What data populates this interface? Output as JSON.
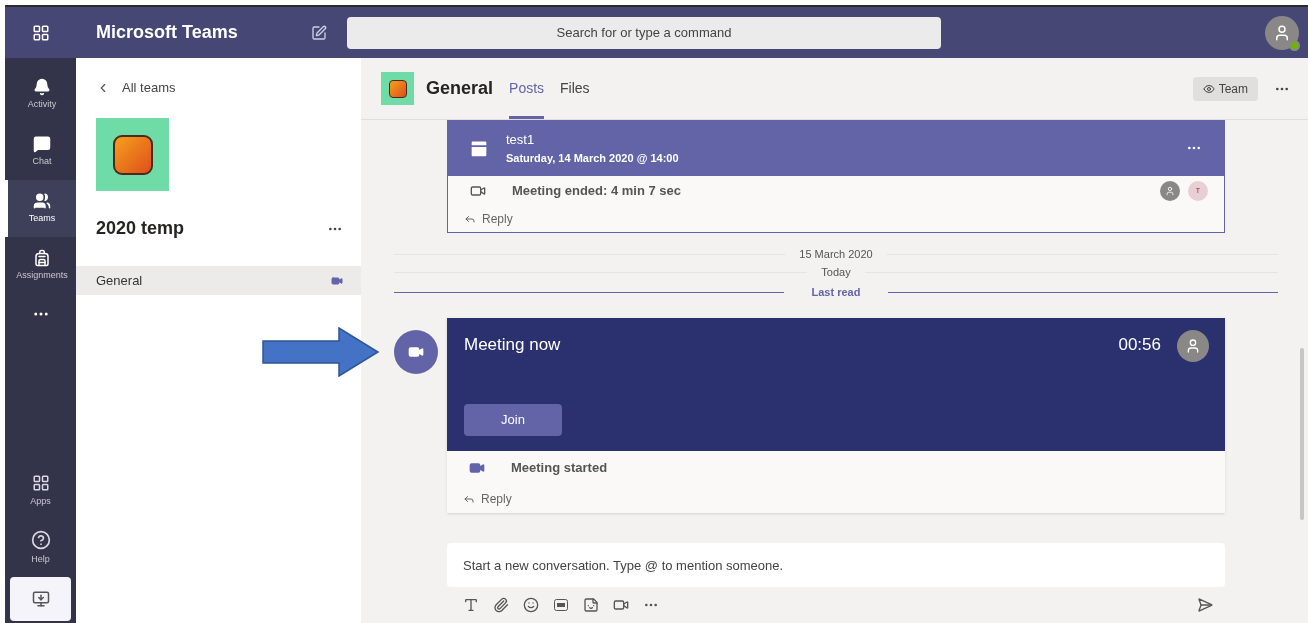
{
  "app": {
    "title": "Microsoft Teams",
    "search": {
      "placeholder": "Search for or type a command"
    }
  },
  "rail": {
    "items": [
      {
        "label": "Activity",
        "kind": "activity",
        "selected": false
      },
      {
        "label": "Chat",
        "kind": "chat",
        "selected": false
      },
      {
        "label": "Teams",
        "kind": "teams",
        "selected": true
      },
      {
        "label": "Assignments",
        "kind": "assignments",
        "selected": false
      }
    ],
    "bottom_items": [
      {
        "label": "Apps",
        "kind": "apps"
      },
      {
        "label": "Help",
        "kind": "help"
      }
    ]
  },
  "team_panel": {
    "back": "All teams",
    "team_name": "2020 temp",
    "channels": [
      {
        "name": "General",
        "selected": true,
        "meeting_active": true
      }
    ]
  },
  "channel": {
    "name": "General",
    "tabs": [
      {
        "label": "Posts",
        "selected": true
      },
      {
        "label": "Files",
        "selected": false
      }
    ],
    "team_button": "Team"
  },
  "posts": [
    {
      "title": "test1",
      "subtitle": "Saturday, 14 March 2020 @ 14:00",
      "status": "Meeting ended: 4 min 7 sec",
      "reply": "Reply",
      "participants": [
        {
          "color": "#8a8886"
        },
        {
          "initial": "T",
          "color": "#e8cfd6"
        }
      ]
    }
  ],
  "separators": [
    {
      "kind": "date",
      "label": "15 March 2020"
    },
    {
      "kind": "date",
      "label": "Today"
    },
    {
      "kind": "last_read",
      "label": "Last read"
    }
  ],
  "live_meeting": {
    "title": "Meeting now",
    "timer": "00:56",
    "join": "Join",
    "status": "Meeting started",
    "reply": "Reply"
  },
  "compose": {
    "placeholder": "Start a new conversation. Type @ to mention someone."
  }
}
